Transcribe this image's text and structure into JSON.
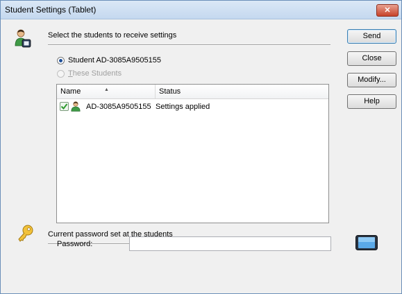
{
  "window": {
    "title": "Student Settings (Tablet)",
    "close_glyph": "✕"
  },
  "receive_section": {
    "title": "Select the students to receive settings",
    "icon": "students-icon",
    "option_student_label": "Student AD-3085A9505155",
    "option_student_selected": true,
    "option_these_prefix": "",
    "option_these_mnemonic": "T",
    "option_these_rest": "hese Students",
    "option_these_enabled": false
  },
  "student_list": {
    "columns": [
      {
        "label": "Name",
        "sorted": true
      },
      {
        "label": "Status"
      }
    ],
    "rows": [
      {
        "name": "AD-3085A9505155",
        "status": "Settings applied",
        "checked": true
      }
    ]
  },
  "buttons": {
    "send": "Send",
    "close": "Close",
    "modify": "Modify...",
    "help": "Help"
  },
  "password_section": {
    "title": "Current password set at the students",
    "icon": "key-icon",
    "label": "Password:",
    "value": ""
  },
  "colors": {
    "accent": "#1e4f98",
    "titlebar": "#c4d8ef",
    "close_button": "#c7432b"
  }
}
